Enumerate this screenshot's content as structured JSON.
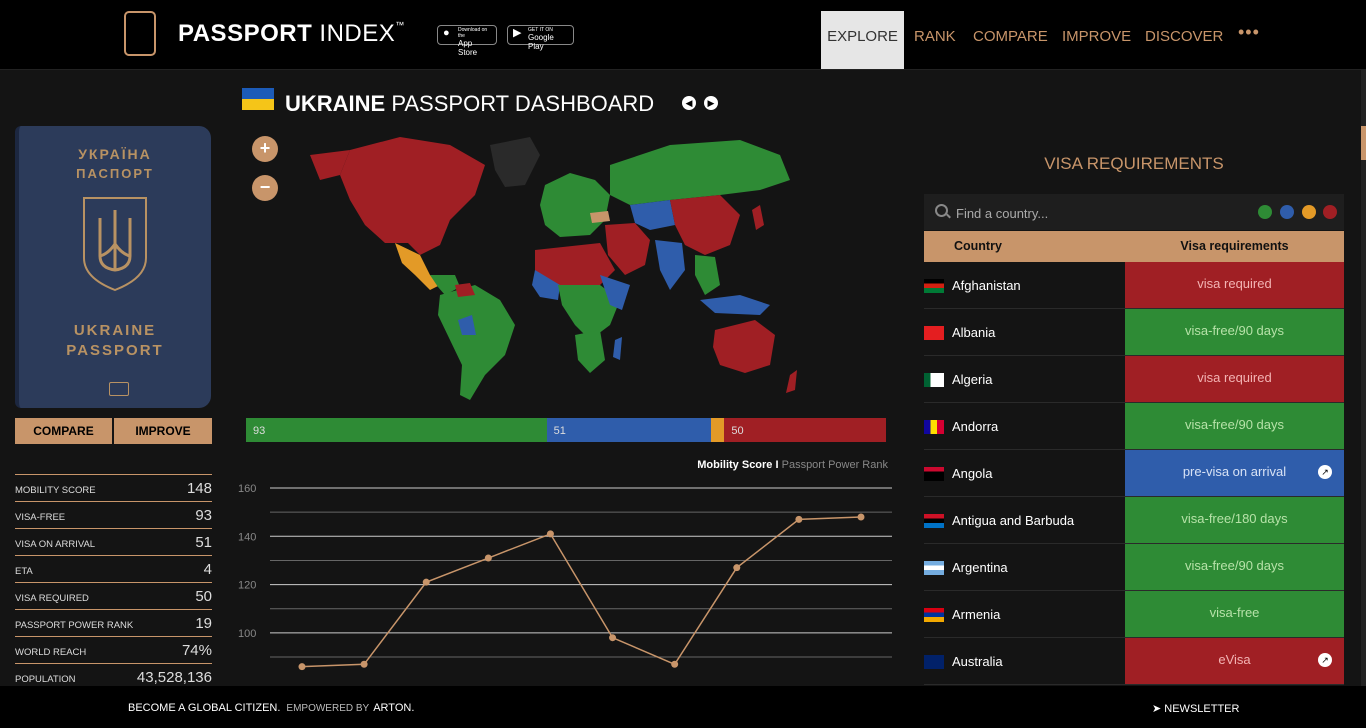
{
  "brand": {
    "bold": "PASSPORT",
    "light": " INDEX",
    "tm": "™"
  },
  "stores": [
    {
      "small": "Download on the",
      "label": "App Store",
      "icon": "apple-icon"
    },
    {
      "small": "GET IT ON",
      "label": "Google Play",
      "icon": "play-icon"
    }
  ],
  "nav": [
    "EXPLORE",
    "RANK",
    "COMPARE",
    "IMPROVE",
    "DISCOVER"
  ],
  "nav_more": "•••",
  "passport": {
    "top1": "УКРАЇНА",
    "top2": "ПАСПОРТ",
    "bottom1": "UKRAINE",
    "bottom2": "PASSPORT"
  },
  "buttons": {
    "compare": "COMPARE",
    "improve": "IMPROVE"
  },
  "stats": [
    {
      "label": "MOBILITY SCORE",
      "value": "148"
    },
    {
      "label": "VISA-FREE",
      "value": "93"
    },
    {
      "label": "VISA ON ARRIVAL",
      "value": "51"
    },
    {
      "label": "ETA",
      "value": "4"
    },
    {
      "label": "VISA REQUIRED",
      "value": "50"
    },
    {
      "label": "PASSPORT POWER RANK",
      "value": "19"
    },
    {
      "label": "WORLD REACH",
      "value": "74%"
    },
    {
      "label": "POPULATION",
      "value": "43,528,136"
    }
  ],
  "dashboard": {
    "country": "UKRAINE",
    "title": " PASSPORT DASHBOARD"
  },
  "colors": {
    "green": "#2e8b35",
    "blue": "#2f5dab",
    "orange": "#e39a27",
    "red": "#a01f24",
    "accent": "#c8956a"
  },
  "breakdown": [
    {
      "label": "93",
      "value": 93,
      "color": "#2e8b35"
    },
    {
      "label": "51",
      "value": 51,
      "color": "#2f5dab"
    },
    {
      "label": "",
      "value": 4,
      "color": "#e39a27"
    },
    {
      "label": "50",
      "value": 50,
      "color": "#a01f24"
    }
  ],
  "chart_caption": {
    "main": "Mobility Score",
    "sep": " I ",
    "secondary": "Passport Power Rank"
  },
  "chart_data": {
    "type": "line",
    "title": "",
    "xlabel": "",
    "ylabel": "",
    "yticks": [
      100,
      120,
      140,
      160
    ],
    "ylim": [
      78,
      160
    ],
    "grid": true,
    "series": [
      {
        "values": [
          86,
          87,
          121,
          131,
          141,
          98,
          87,
          127,
          147,
          148
        ]
      }
    ]
  },
  "visa": {
    "title": "VISA REQUIREMENTS",
    "search_placeholder": "Find a country...",
    "col_country": "Country",
    "col_req": "Visa requirements",
    "rows": [
      {
        "country": "Afghanistan",
        "req": "visa required",
        "type": "red",
        "ext": false
      },
      {
        "country": "Albania",
        "req": "visa-free/90 days",
        "type": "green",
        "ext": false
      },
      {
        "country": "Algeria",
        "req": "visa required",
        "type": "red",
        "ext": false
      },
      {
        "country": "Andorra",
        "req": "visa-free/90 days",
        "type": "green",
        "ext": false
      },
      {
        "country": "Angola",
        "req": "pre-visa on arrival",
        "type": "blue",
        "ext": true
      },
      {
        "country": "Antigua and Barbuda",
        "req": "visa-free/180 days",
        "type": "green",
        "ext": false
      },
      {
        "country": "Argentina",
        "req": "visa-free/90 days",
        "type": "green",
        "ext": false
      },
      {
        "country": "Armenia",
        "req": "visa-free",
        "type": "green",
        "ext": false
      },
      {
        "country": "Australia",
        "req": "eVisa",
        "type": "red",
        "ext": true
      }
    ]
  },
  "footer": {
    "tagline": "BECOME A GLOBAL CITIZEN.",
    "powered": "EMPOWERED BY",
    "arton": "ARTON.",
    "newsletter": "NEWSLETTER"
  }
}
